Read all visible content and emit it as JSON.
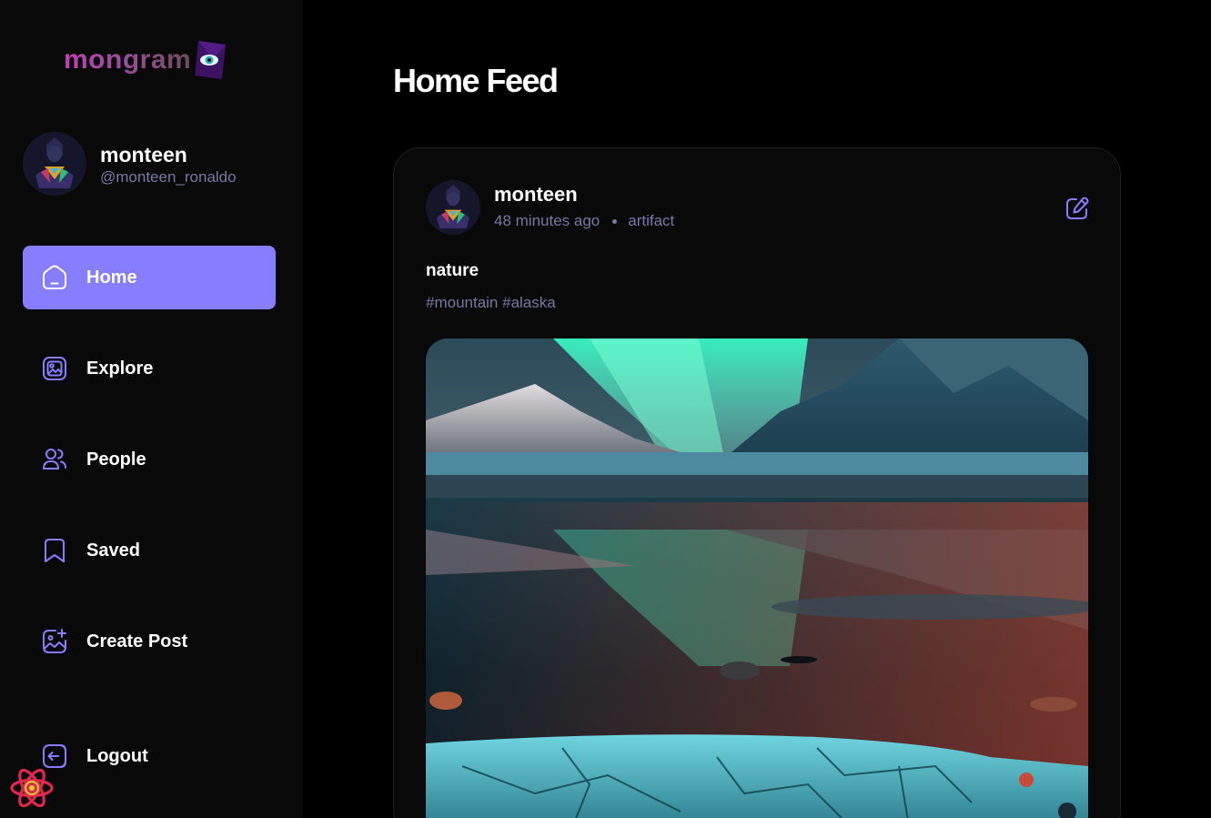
{
  "app": {
    "logo_text": "mongram"
  },
  "user": {
    "name": "monteen",
    "handle": "@monteen_ronaldo"
  },
  "nav": {
    "items": [
      {
        "label": "Home",
        "icon": "home-icon",
        "active": true
      },
      {
        "label": "Explore",
        "icon": "gallery-icon",
        "active": false
      },
      {
        "label": "People",
        "icon": "people-icon",
        "active": false
      },
      {
        "label": "Saved",
        "icon": "bookmark-icon",
        "active": false
      },
      {
        "label": "Create Post",
        "icon": "add-image-icon",
        "active": false
      }
    ],
    "logout_label": "Logout"
  },
  "main": {
    "title": "Home Feed"
  },
  "post": {
    "author": "monteen",
    "time": "48 minutes ago",
    "location": "artifact",
    "caption": "nature",
    "tags": "#mountain #alaska",
    "image_icon": "landscape-photo"
  },
  "colors": {
    "accent": "#877eff",
    "muted": "#7877a6",
    "sidebar_bg": "#09090a",
    "page_bg": "#000000"
  }
}
